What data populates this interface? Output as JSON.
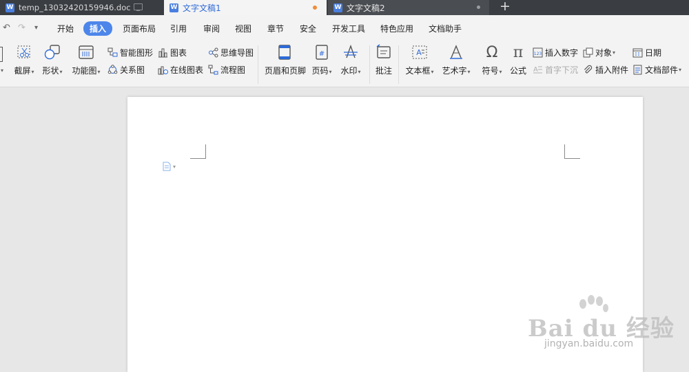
{
  "tabs": [
    {
      "title": "temp_13032420159946.doc",
      "icon": "wps-writer-icon",
      "state": "inactive"
    },
    {
      "title": "文字文稿1",
      "icon": "wps-writer-icon",
      "state": "active",
      "dot_color": "#f08c3a"
    },
    {
      "title": "文字文稿2",
      "icon": "wps-writer-icon",
      "state": "inactive"
    }
  ],
  "new_tab_symbol": "+",
  "menu": [
    "开始",
    "插入",
    "页面布局",
    "引用",
    "审阅",
    "视图",
    "章节",
    "安全",
    "开发工具",
    "特色应用",
    "文档助手"
  ],
  "active_menu": "插入",
  "ribbon": {
    "screenshot": "截屏",
    "shapes": "形状",
    "function_chart": "功能图",
    "smart_graphic": "智能图形",
    "relation_chart": "关系图",
    "chart": "图表",
    "online_chart": "在线图表",
    "mind_map": "思维导图",
    "flow_chart": "流程图",
    "header_footer": "页眉和页脚",
    "page_number": "页码",
    "watermark": "水印",
    "comment": "批注",
    "text_box": "文本框",
    "word_art": "艺术字",
    "symbol": "符号",
    "formula": "公式",
    "insert_number": "插入数字",
    "drop_cap": "首字下沉",
    "object": "对象",
    "attachment": "插入附件",
    "date": "日期",
    "doc_parts": "文档部件"
  },
  "watermark_brand": {
    "logo_text": "Bai du 经验",
    "url": "jingyan.baidu.com"
  },
  "colors": {
    "accent": "#4d86ea",
    "active_tab_text": "#2d6ad8",
    "tab_bar": "#3a3d42"
  }
}
